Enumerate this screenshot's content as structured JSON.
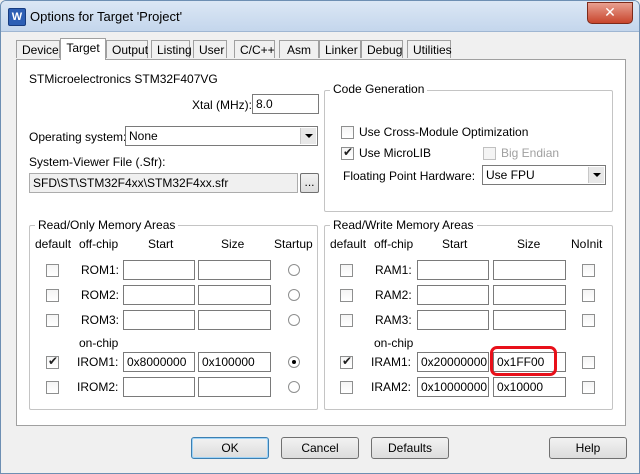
{
  "window": {
    "title": "Options for Target 'Project'",
    "app_icon": "W",
    "close_glyph": "✕"
  },
  "tabs": [
    "Device",
    "Target",
    "Output",
    "Listing",
    "User",
    "C/C++",
    "Asm",
    "Linker",
    "Debug",
    "Utilities"
  ],
  "active_tab": "Target",
  "device_name": "STMicroelectronics STM32F407VG",
  "xtal": {
    "label": "Xtal (MHz):",
    "value": "8.0"
  },
  "os": {
    "label": "Operating system:",
    "value": "None"
  },
  "sfr": {
    "label": "System-Viewer File (.Sfr):",
    "value": "SFD\\ST\\STM32F4xx\\STM32F4xx.sfr",
    "browse": "..."
  },
  "codegen": {
    "title": "Code Generation",
    "cross_module": "Use Cross-Module Optimization",
    "microlib": "Use MicroLIB",
    "big_endian": "Big Endian",
    "fph_label": "Floating Point Hardware:",
    "fph_value": "Use FPU"
  },
  "ro_memory": {
    "title": "Read/Only Memory Areas",
    "headers": {
      "default": "default",
      "offchip": "off-chip",
      "start": "Start",
      "size": "Size",
      "startup": "Startup"
    },
    "onchip_label": "on-chip",
    "rows": [
      {
        "name": "ROM1:",
        "start": "",
        "size": "",
        "default": false,
        "startup": false
      },
      {
        "name": "ROM2:",
        "start": "",
        "size": "",
        "default": false,
        "startup": false
      },
      {
        "name": "ROM3:",
        "start": "",
        "size": "",
        "default": false,
        "startup": false
      },
      {
        "name": "IROM1:",
        "start": "0x8000000",
        "size": "0x100000",
        "default": true,
        "startup": true
      },
      {
        "name": "IROM2:",
        "start": "",
        "size": "",
        "default": false,
        "startup": false
      }
    ]
  },
  "rw_memory": {
    "title": "Read/Write Memory Areas",
    "headers": {
      "default": "default",
      "offchip": "off-chip",
      "start": "Start",
      "size": "Size",
      "noinit": "NoInit"
    },
    "onchip_label": "on-chip",
    "rows": [
      {
        "name": "RAM1:",
        "start": "",
        "size": "",
        "default": false,
        "noinit": false
      },
      {
        "name": "RAM2:",
        "start": "",
        "size": "",
        "default": false,
        "noinit": false
      },
      {
        "name": "RAM3:",
        "start": "",
        "size": "",
        "default": false,
        "noinit": false
      },
      {
        "name": "IRAM1:",
        "start": "0x20000000",
        "size": "0x1FF00",
        "default": true,
        "noinit": false
      },
      {
        "name": "IRAM2:",
        "start": "0x10000000",
        "size": "0x10000",
        "default": false,
        "noinit": false
      }
    ]
  },
  "buttons": {
    "ok": "OK",
    "cancel": "Cancel",
    "defaults": "Defaults",
    "help": "Help"
  },
  "colors": {
    "highlight": "#e8101a",
    "title_bar": "#c4d6ec",
    "close_button": "#c8452c"
  }
}
